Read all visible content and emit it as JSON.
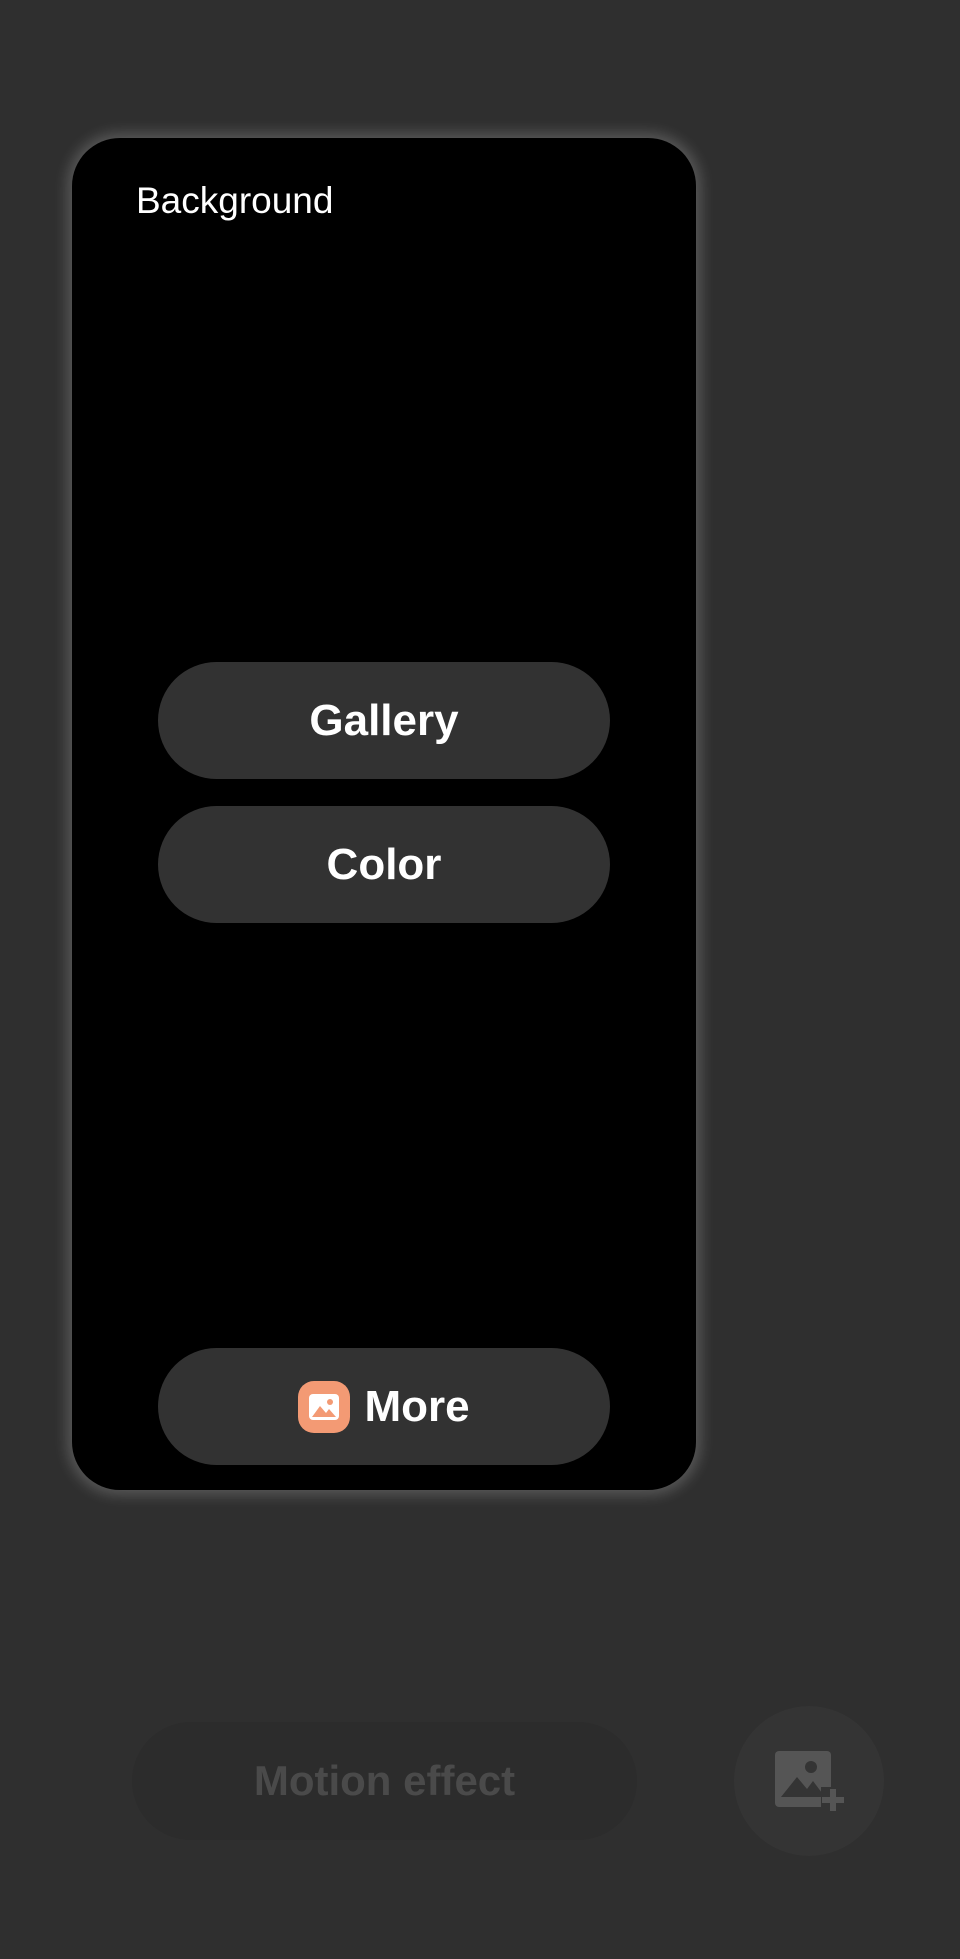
{
  "panel": {
    "title": "Background",
    "options": {
      "gallery_label": "Gallery",
      "color_label": "Color",
      "more_label": "More",
      "more_icon": "gallery-icon"
    }
  },
  "bottom": {
    "motion_effect_label": "Motion effect",
    "add_image_icon": "add-image-icon"
  },
  "colors": {
    "background": "#2f2f2f",
    "panel": "#000000",
    "pill": "#323232",
    "accent": "#f39a74"
  }
}
